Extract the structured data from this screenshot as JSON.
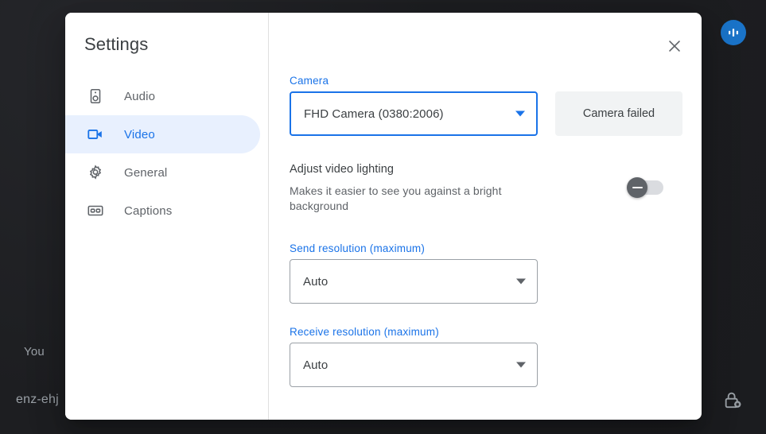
{
  "background": {
    "self_label": "You",
    "meeting_code": "enz-ehj",
    "avatar_icon": "audio-levels-icon",
    "lock_icon": "lock-icon",
    "background_color": "#1e1f22"
  },
  "dialog": {
    "title": "Settings",
    "close_label": "Close",
    "close_icon": "close-icon"
  },
  "sidebar": {
    "items": [
      {
        "label": "Audio",
        "icon": "speaker-icon",
        "active": false
      },
      {
        "label": "Video",
        "icon": "videocam-icon",
        "active": true
      },
      {
        "label": "General",
        "icon": "gear-icon",
        "active": false
      },
      {
        "label": "Captions",
        "icon": "cc-icon",
        "active": false
      }
    ],
    "active_color": "#1a73e8",
    "active_background": "#e8f0fe"
  },
  "video_panel": {
    "camera": {
      "label": "Camera",
      "selected": "FHD Camera (0380:2006)",
      "focused": true,
      "status_button": "Camera failed",
      "dropdown_icon": "chevron-down-icon"
    },
    "lighting": {
      "title": "Adjust video lighting",
      "description": "Makes it easier to see you against a bright background",
      "toggle_state": "off",
      "toggle_icon": "minus-icon"
    },
    "send_resolution": {
      "label": "Send resolution (maximum)",
      "selected": "Auto",
      "dropdown_icon": "chevron-down-icon"
    },
    "receive_resolution": {
      "label": "Receive resolution (maximum)",
      "selected": "Auto",
      "dropdown_icon": "chevron-down-icon"
    }
  },
  "colors": {
    "accent": "#1a73e8",
    "text_primary": "#3c4043",
    "text_secondary": "#5f6368",
    "border": "#9aa0a6",
    "surface_muted": "#f1f3f4"
  }
}
